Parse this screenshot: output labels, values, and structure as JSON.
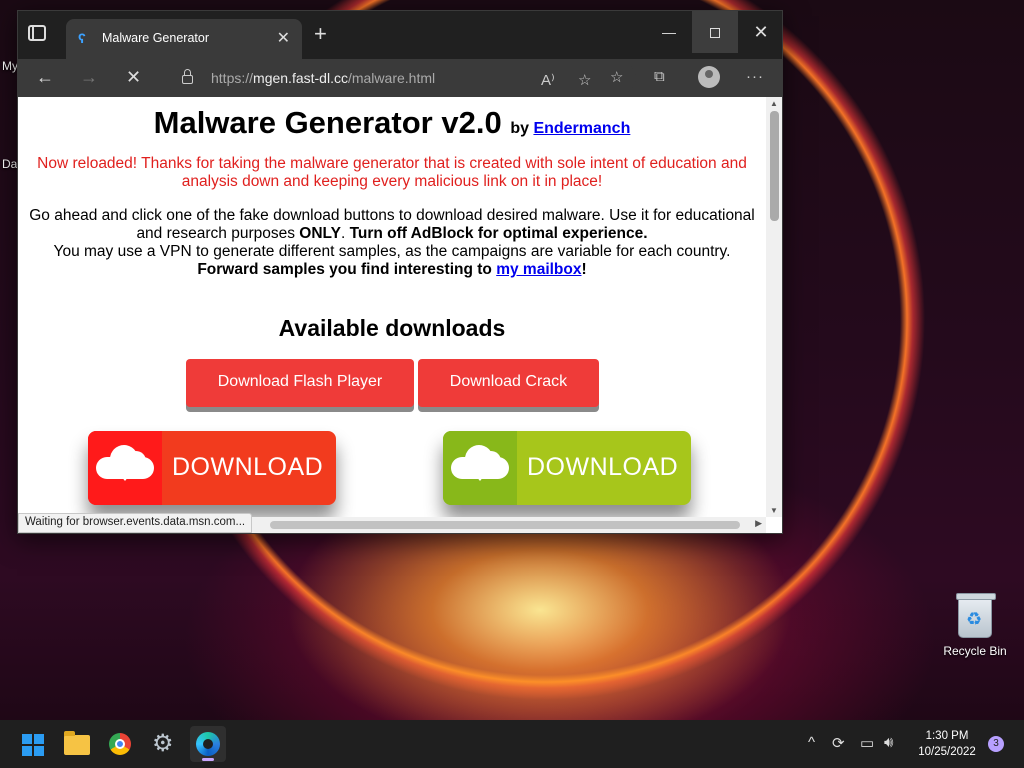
{
  "desktop": {
    "frag_my": "My",
    "frag_da": "Da",
    "recycle_bin_label": "Recycle Bin"
  },
  "browser": {
    "tab_title": "Malware Generator",
    "url_prefix": "https://",
    "url_host": "mgen.fast-dl.cc",
    "url_path": "/malware.html",
    "status_text": "Waiting for browser.events.data.msn.com..."
  },
  "page": {
    "title": "Malware Generator v2.0",
    "by_label": "by",
    "author_link": "Endermanch",
    "notice": "Now reloaded! Thanks for taking the malware generator that is created with sole intent of education and analysis down and keeping every malicious link on it in place!",
    "info_1": "Go ahead and click one of the fake download buttons to download desired malware. Use it for educational and research purposes",
    "info_only": "ONLY",
    "info_dot": ".",
    "info_adblock": "Turn off AdBlock for optimal experience.",
    "info_2": "You may use a VPN to generate different samples, as the campaigns are variable for each country.",
    "info_forward": "Forward samples you find interesting to",
    "mailbox_link": "my mailbox",
    "info_excl": "!",
    "downloads_heading": "Available downloads",
    "btn_flash": "Download Flash Player",
    "btn_crack": "Download Crack",
    "big_download_red": "DOWNLOAD",
    "big_download_green": "DOWNLOAD",
    "colors": {
      "red_button": "#ef3b39",
      "big_red_left": "#ff1a1a",
      "big_red_right": "#f23b1e",
      "big_green_left": "#88b81a",
      "big_green_right": "#a7c61b"
    }
  },
  "taskbar": {
    "time": "1:30 PM",
    "date": "10/25/2022",
    "notification_count": "3"
  }
}
